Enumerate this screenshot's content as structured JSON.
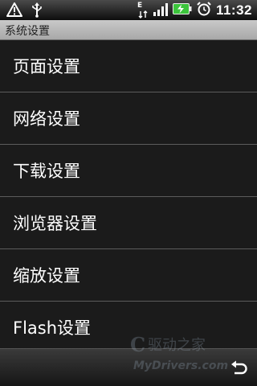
{
  "status_bar": {
    "time": "11:32",
    "network_type": "E",
    "icons": [
      "warning-icon",
      "usb-icon",
      "edge-network-icon",
      "signal-icon",
      "battery-charging-icon",
      "alarm-icon"
    ]
  },
  "title_bar": {
    "title": "系统设置"
  },
  "list": {
    "items": [
      {
        "label": "页面设置"
      },
      {
        "label": "网络设置"
      },
      {
        "label": "下载设置"
      },
      {
        "label": "浏览器设置"
      },
      {
        "label": "缩放设置"
      },
      {
        "label": "Flash设置"
      }
    ]
  },
  "bottom_bar": {
    "icon": "back-arrow-icon"
  },
  "watermark": {
    "text": "MyDrivers.com"
  },
  "colors": {
    "list_background": "#1b1b1b",
    "divider": "#5c5c5c",
    "title_bar": "#b8b8b8",
    "battery_green": "#3cc43c"
  }
}
